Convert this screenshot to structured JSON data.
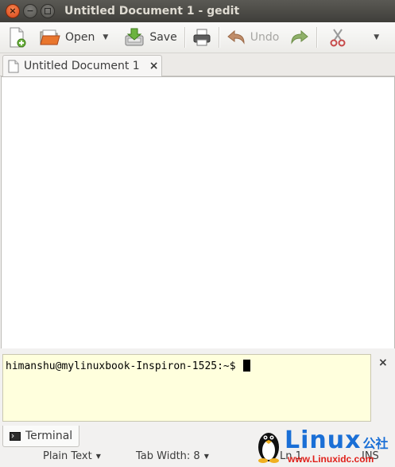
{
  "window": {
    "title": "Untitled Document 1 - gedit"
  },
  "toolbar": {
    "open_label": "Open",
    "save_label": "Save",
    "undo_label": "Undo"
  },
  "tabs": [
    {
      "label": "Untitled Document 1",
      "close_glyph": "×"
    }
  ],
  "panel": {
    "terminal_prompt": "himanshu@mylinuxbook-Inspiron-1525:~$",
    "tab_label": "Terminal",
    "close_glyph": "×"
  },
  "statusbar": {
    "language": "Plain Text",
    "tab_width": "Tab Width: 8",
    "position": "Ln 1",
    "mode": "INS"
  },
  "watermark": {
    "brand": "Linux",
    "suffix": "公社",
    "url": "www.Linuxidc.com"
  },
  "colors": {
    "terminal_bg": "#ffffdd",
    "close_button": "#e95420",
    "watermark_blue": "#1a6fd6",
    "watermark_red": "#e0201a"
  }
}
